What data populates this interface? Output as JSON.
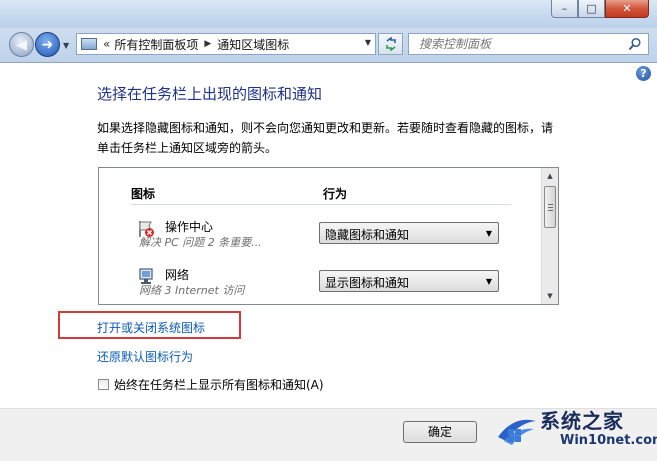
{
  "window": {
    "minimize_glyph": "–",
    "maximize_glyph": "□",
    "close_glyph": "✕"
  },
  "nav": {
    "breadcrumb_prefix": "«",
    "crumbs": [
      "所有控制面板项",
      "通知区域图标"
    ],
    "search_placeholder": "搜索控制面板"
  },
  "content": {
    "title": "选择在任务栏上出现的图标和通知",
    "description": "如果选择隐藏图标和通知，则不会向您通知更改和更新。若要随时查看隐藏的图标，请单击任务栏上通知区域旁的箭头。",
    "table": {
      "headers": {
        "icon": "图标",
        "behavior": "行为"
      },
      "rows": [
        {
          "name": "操作中心",
          "desc": "解决 PC 问题  2 条重要...",
          "behavior": "隐藏图标和通知",
          "icon": "action-center-flag-icon"
        },
        {
          "name": "网络",
          "desc": "网络 3 Internet 访问",
          "behavior": "显示图标和通知",
          "icon": "network-icon"
        }
      ]
    },
    "link_system_icons": "打开或关闭系统图标",
    "link_restore": "还原默认图标行为",
    "checkbox_label": "始终在任务栏上显示所有图标和通知(A)",
    "checkbox_checked": false
  },
  "footer": {
    "ok_label": "确定"
  },
  "watermark": {
    "cn": "系统之家",
    "en": "Win10net.com"
  },
  "colors": {
    "title": "#1e3287",
    "link": "#0b5bb8",
    "highlight": "#d23b3b"
  }
}
